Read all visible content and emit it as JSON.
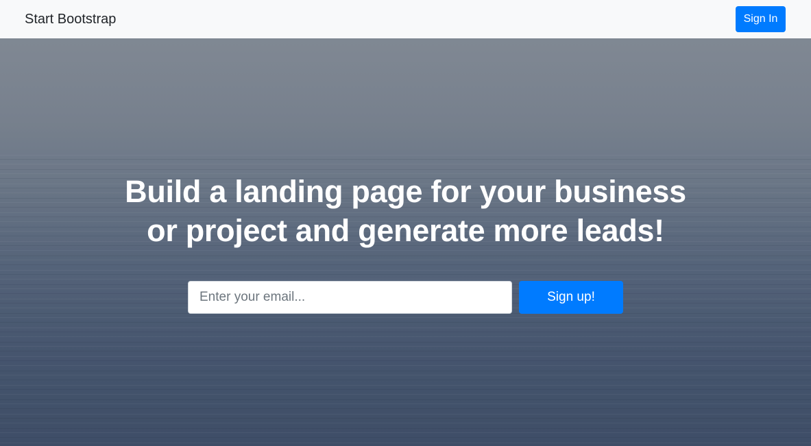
{
  "navbar": {
    "brand": "Start Bootstrap",
    "signin_label": "Sign In"
  },
  "hero": {
    "headline_line1": "Build a landing page for your business",
    "headline_line2": "or project and generate more leads!",
    "email_placeholder": "Enter your email...",
    "signup_label": "Sign up!"
  },
  "colors": {
    "primary": "#007bff",
    "navbar_bg": "#f8f9fa",
    "brand_text": "#212529",
    "headline_text": "#ffffff"
  }
}
